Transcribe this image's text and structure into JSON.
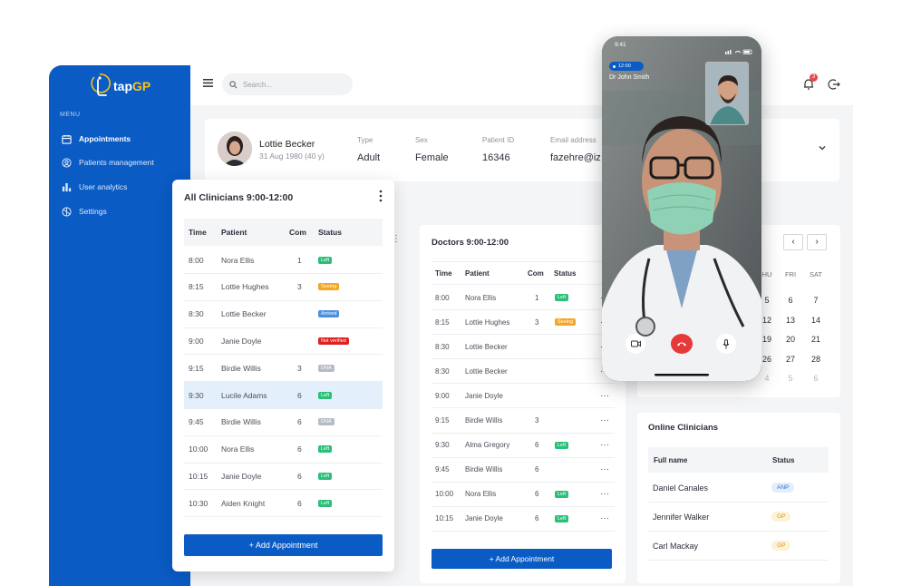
{
  "brand": {
    "name_a": "tap",
    "name_b": "GP"
  },
  "sidebar": {
    "menu_label": "MENU",
    "items": [
      {
        "label": "Appointments",
        "icon": "calendar-icon"
      },
      {
        "label": "Patients management",
        "icon": "user-circle-icon"
      },
      {
        "label": "User analytics",
        "icon": "bar-chart-icon"
      },
      {
        "label": "Settings",
        "icon": "settings-icon"
      }
    ]
  },
  "topbar": {
    "search_placeholder": "Search...",
    "notification_count": "3"
  },
  "patient": {
    "name": "Lottie Becker",
    "dob": "31 Aug 1980 (40 y)",
    "fields": [
      {
        "label": "Type",
        "value": "Adult"
      },
      {
        "label": "Sex",
        "value": "Female"
      },
      {
        "label": "Patient ID",
        "value": "16346"
      },
      {
        "label": "Email address",
        "value": "fazehre@iz"
      }
    ]
  },
  "all_clinicians": {
    "title": "All Clinicians 9:00-12:00",
    "columns": [
      "Time",
      "Patient",
      "Com",
      "Status"
    ],
    "rows": [
      {
        "time": "8:00",
        "patient": "Nora Ellis",
        "com": "1",
        "status": "Left"
      },
      {
        "time": "8:15",
        "patient": "Lottie Hughes",
        "com": "3",
        "status": "Seeing"
      },
      {
        "time": "8:30",
        "patient": "Lottie Becker",
        "com": "",
        "status": "Arrived"
      },
      {
        "time": "9:00",
        "patient": "Janie Doyle",
        "com": "",
        "status": "Not verified"
      },
      {
        "time": "9:15",
        "patient": "Birdie Willis",
        "com": "3",
        "status": "DNA"
      },
      {
        "time": "9:30",
        "patient": "Lucile Adams",
        "com": "6",
        "status": "Left"
      },
      {
        "time": "9:45",
        "patient": "Birdie Willis",
        "com": "6",
        "status": "DNA"
      },
      {
        "time": "10:00",
        "patient": "Nora Ellis",
        "com": "6",
        "status": "Left"
      },
      {
        "time": "10:15",
        "patient": "Janie Doyle",
        "com": "6",
        "status": "Left"
      },
      {
        "time": "10:30",
        "patient": "Aiden Knight",
        "com": "6",
        "status": "Left"
      }
    ],
    "add_button": "+ Add Appointment"
  },
  "doctors": {
    "title": "Doctors 9:00-12:00",
    "columns": [
      "Time",
      "Patient",
      "Com",
      "Status"
    ],
    "rows": [
      {
        "time": "8:00",
        "patient": "Nora Ellis",
        "com": "1",
        "status": "Left"
      },
      {
        "time": "8:15",
        "patient": "Lottie Hughes",
        "com": "3",
        "status": "Seeing"
      },
      {
        "time": "8:30",
        "patient": "Lottie Becker",
        "com": "",
        "status": ""
      },
      {
        "time": "8:30",
        "patient": "Lottie Becker",
        "com": "",
        "status": ""
      },
      {
        "time": "9:00",
        "patient": "Janie Doyle",
        "com": "",
        "status": ""
      },
      {
        "time": "9:15",
        "patient": "Birdie Willis",
        "com": "3",
        "status": ""
      },
      {
        "time": "9:30",
        "patient": "Alma Gregory",
        "com": "6",
        "status": "Left"
      },
      {
        "time": "9:45",
        "patient": "Birdie Willis",
        "com": "6",
        "status": ""
      },
      {
        "time": "10:00",
        "patient": "Nora Ellis",
        "com": "6",
        "status": "Left"
      },
      {
        "time": "10:15",
        "patient": "Janie Doyle",
        "com": "6",
        "status": "Left"
      }
    ],
    "add_button": "+ Add Appointment"
  },
  "calendar": {
    "weekdays": [
      "HU",
      "FRI",
      "SAT"
    ],
    "weeks": [
      [
        "5",
        "6",
        "7"
      ],
      [
        "12",
        "13",
        "14"
      ],
      [
        "19",
        "20",
        "21"
      ],
      [
        "26",
        "27",
        "28"
      ],
      [
        "4",
        "5",
        "6"
      ]
    ]
  },
  "online": {
    "title": "Online Clinicians",
    "columns": [
      "Full name",
      "Status"
    ],
    "rows": [
      {
        "name": "Daniel Canales",
        "role": "ANP"
      },
      {
        "name": "Jennifer Walker",
        "role": "GP"
      },
      {
        "name": "Carl Mackay",
        "role": "GP"
      }
    ]
  },
  "call": {
    "clock": "9:41",
    "duration": "12:00",
    "caller": "Dr John Smith"
  },
  "colors": {
    "brand_blue": "#0a5bc4",
    "left": "#2bbf7a",
    "seeing": "#f5a623",
    "arrived": "#4a90e2",
    "not_verified": "#e02020",
    "dna": "#b6bcc4"
  }
}
